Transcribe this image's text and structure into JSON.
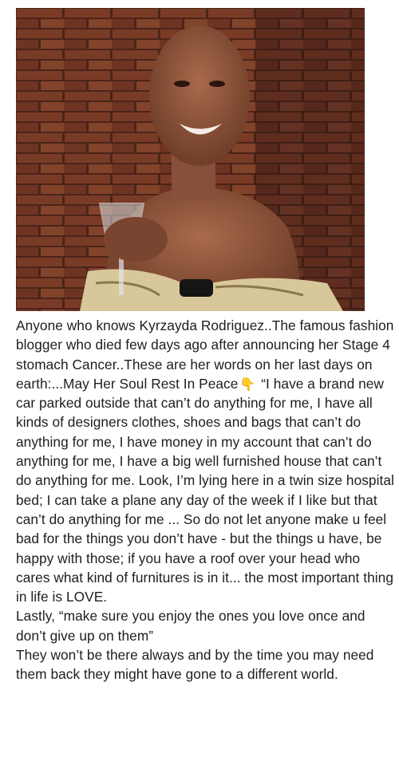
{
  "post": {
    "photo_icon": "portrait-photo",
    "intro": "Anyone who knows Kyrzayda Rodriguez..The famous fashion blogger who died few days ago after announcing her Stage 4 stomach Cancer..These are her words on her last days on earth:...May Her Soul",
    "rip": "Rest In Peace",
    "rip_emoji": "👇",
    "quote": "“I have a brand new car parked outside that can’t do anything for me, I have all kinds of designers clothes, shoes and bags that can’t do anything for me, I have money in my account that can’t do anything for me, I have a big well furnished house that can’t do anything for me. Look, I’m lying here in a twin size hospital bed; I can take a plane any day of the week if I like but that can’t do anything for me ... So do not let anyone make u feel bad for the things you don’t have - but the things u have, be happy with those; if you have a roof over your head who cares what kind of furnitures is in it... the most important thing in life is LOVE.",
    "lastly": "Lastly, “make sure you enjoy the ones you love once and don’t give up on them”",
    "closing": "They won’t be there always and by the time you may need them back they might have gone to a different world."
  },
  "colors": {
    "text": "#1c1e21",
    "brick": "#6b3322",
    "skin": "#8a5238"
  }
}
